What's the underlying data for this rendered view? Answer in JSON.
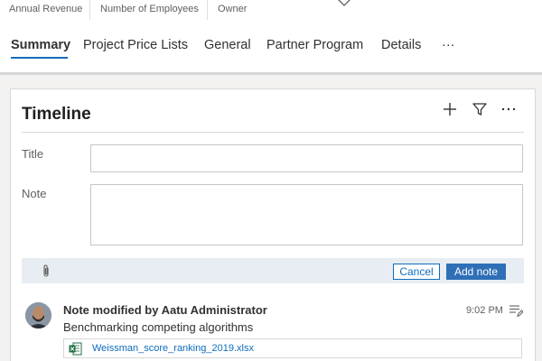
{
  "header_fields": {
    "annual_revenue_label": "Annual Revenue",
    "employees_label": "Number of Employees",
    "owner_label": "Owner"
  },
  "tabs": [
    {
      "label": "Summary",
      "active": true
    },
    {
      "label": "Project Price Lists",
      "active": false
    },
    {
      "label": "General",
      "active": false
    },
    {
      "label": "Partner Program",
      "active": false
    },
    {
      "label": "Details",
      "active": false
    },
    {
      "label": "···",
      "active": false
    }
  ],
  "timeline": {
    "title": "Timeline",
    "icons": [
      "plus-icon",
      "filter-icon",
      "more-icon"
    ],
    "form": {
      "title_label": "Title",
      "title_value": "",
      "note_label": "Note",
      "note_value": "",
      "cancel_label": "Cancel",
      "add_note_label": "Add note"
    },
    "entry": {
      "title": "Note modified by Aatu Administrator",
      "body": "Benchmarking competing algorithms",
      "time": "9:02 PM",
      "attachment": "Weissman_score_ranking_2019.xlsx"
    }
  },
  "colors": {
    "accent": "#0f6cbd",
    "add_button": "#2f6fb7",
    "action_bar": "#e8edf3"
  }
}
